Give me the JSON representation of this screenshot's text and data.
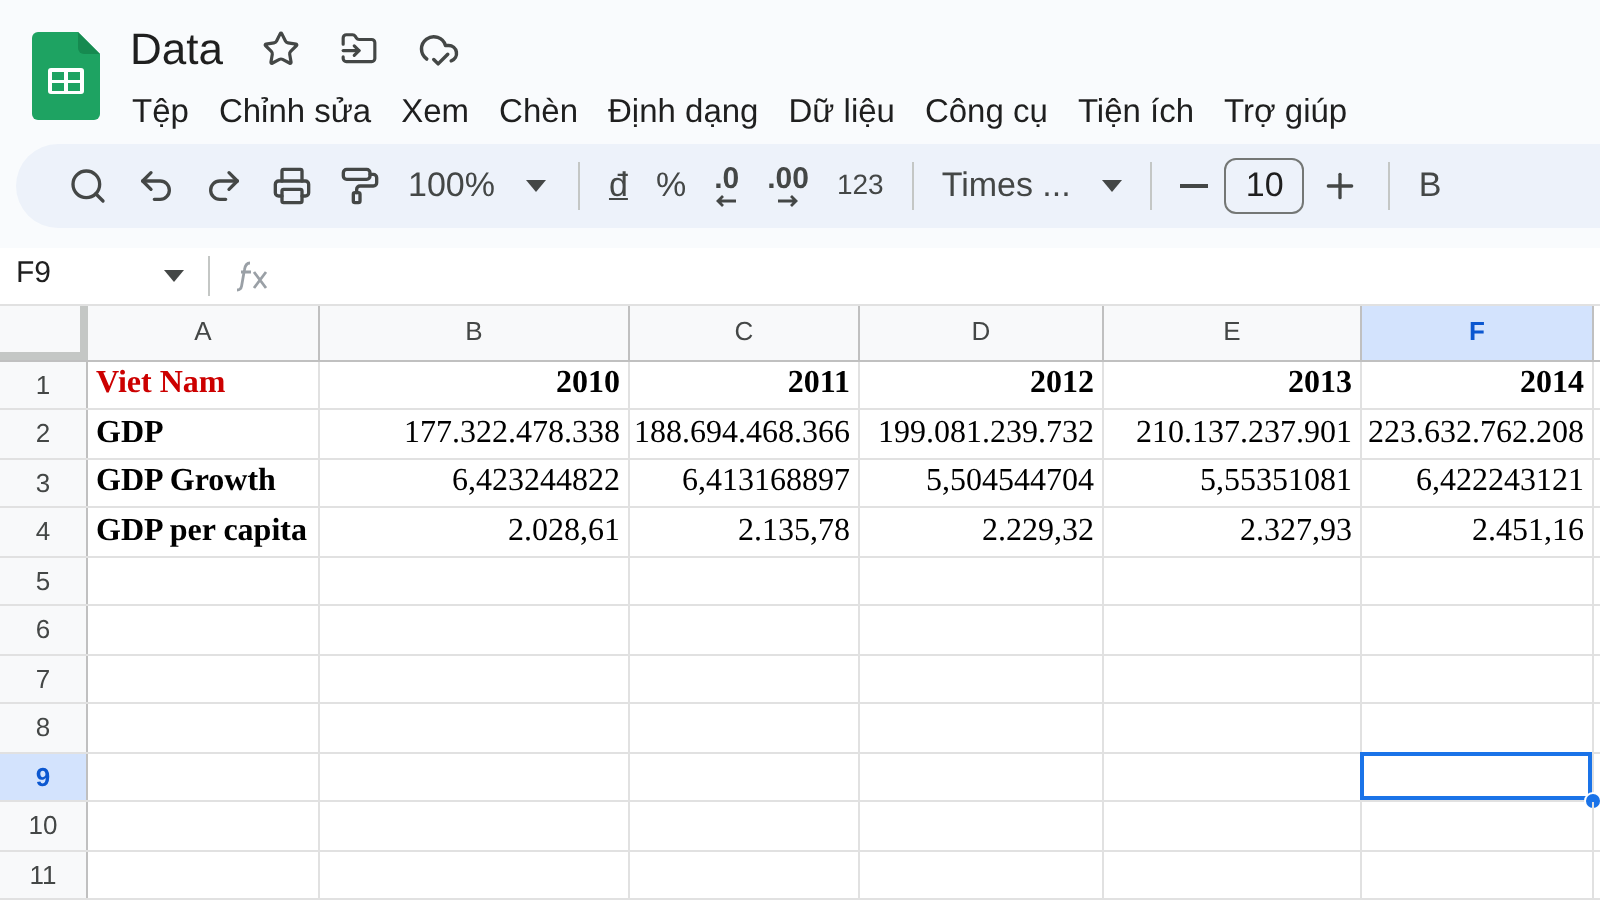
{
  "document": {
    "title": "Data"
  },
  "menu": [
    "Tệp",
    "Chỉnh sửa",
    "Xem",
    "Chèn",
    "Định dạng",
    "Dữ liệu",
    "Công cụ",
    "Tiện ích",
    "Trợ giúp"
  ],
  "toolbar": [
    {
      "kind": "search"
    },
    {
      "kind": "undo"
    },
    {
      "kind": "redo"
    },
    {
      "kind": "print"
    },
    {
      "kind": "paint"
    },
    {
      "kind": "zoom",
      "label": "100%"
    },
    {
      "kind": "sep"
    },
    {
      "kind": "text",
      "label": "đ",
      "underline": true
    },
    {
      "kind": "text",
      "label": "%",
      "underline": false
    },
    {
      "kind": "dec-less",
      "label": ".0"
    },
    {
      "kind": "dec-more",
      "label": ".00"
    },
    {
      "kind": "small",
      "label": "123"
    },
    {
      "kind": "sep"
    },
    {
      "kind": "font",
      "label": "Times ..."
    },
    {
      "kind": "sep"
    },
    {
      "kind": "minus"
    },
    {
      "kind": "size",
      "label": "10"
    },
    {
      "kind": "plus"
    },
    {
      "kind": "sep"
    },
    {
      "kind": "text",
      "label": "B",
      "underline": false
    }
  ],
  "formula_bar": {
    "cell_ref": "F9"
  },
  "columns": [
    {
      "label": "A",
      "selected": false
    },
    {
      "label": "B",
      "selected": false
    },
    {
      "label": "C",
      "selected": false
    },
    {
      "label": "D",
      "selected": false
    },
    {
      "label": "E",
      "selected": false
    },
    {
      "label": "F",
      "selected": true
    }
  ],
  "rows": [
    {
      "label": "1",
      "selected": false,
      "cells": [
        {
          "value": "Viet Nam",
          "bold": true,
          "color": "#cc0000"
        },
        {
          "value": "2010",
          "bold": true
        },
        {
          "value": "2011",
          "bold": true
        },
        {
          "value": "2012",
          "bold": true
        },
        {
          "value": "2013",
          "bold": true
        },
        {
          "value": "2014",
          "bold": true
        }
      ]
    },
    {
      "label": "2",
      "selected": false,
      "cells": [
        {
          "value": "GDP",
          "bold": true
        },
        {
          "value": "177.322.478.338",
          "bold": false
        },
        {
          "value": "188.694.468.366",
          "bold": false
        },
        {
          "value": "199.081.239.732",
          "bold": false
        },
        {
          "value": "210.137.237.901",
          "bold": false
        },
        {
          "value": "223.632.762.208",
          "bold": false
        }
      ]
    },
    {
      "label": "3",
      "selected": false,
      "cells": [
        {
          "value": "GDP Growth",
          "bold": true
        },
        {
          "value": "6,423244822",
          "bold": false
        },
        {
          "value": "6,413168897",
          "bold": false
        },
        {
          "value": "5,504544704",
          "bold": false
        },
        {
          "value": "5,55351081",
          "bold": false
        },
        {
          "value": "6,422243121",
          "bold": false
        }
      ]
    },
    {
      "label": "4",
      "selected": false,
      "cells": [
        {
          "value": "GDP per capita",
          "bold": true
        },
        {
          "value": "2.028,61",
          "bold": false
        },
        {
          "value": "2.135,78",
          "bold": false
        },
        {
          "value": "2.229,32",
          "bold": false
        },
        {
          "value": "2.327,93",
          "bold": false
        },
        {
          "value": "2.451,16",
          "bold": false
        }
      ]
    },
    {
      "label": "5",
      "selected": false,
      "cells": []
    },
    {
      "label": "6",
      "selected": false,
      "cells": []
    },
    {
      "label": "7",
      "selected": false,
      "cells": []
    },
    {
      "label": "8",
      "selected": false,
      "cells": []
    },
    {
      "label": "9",
      "selected": true,
      "cells": []
    },
    {
      "label": "10",
      "selected": false,
      "cells": []
    },
    {
      "label": "11",
      "selected": false,
      "cells": []
    }
  ]
}
